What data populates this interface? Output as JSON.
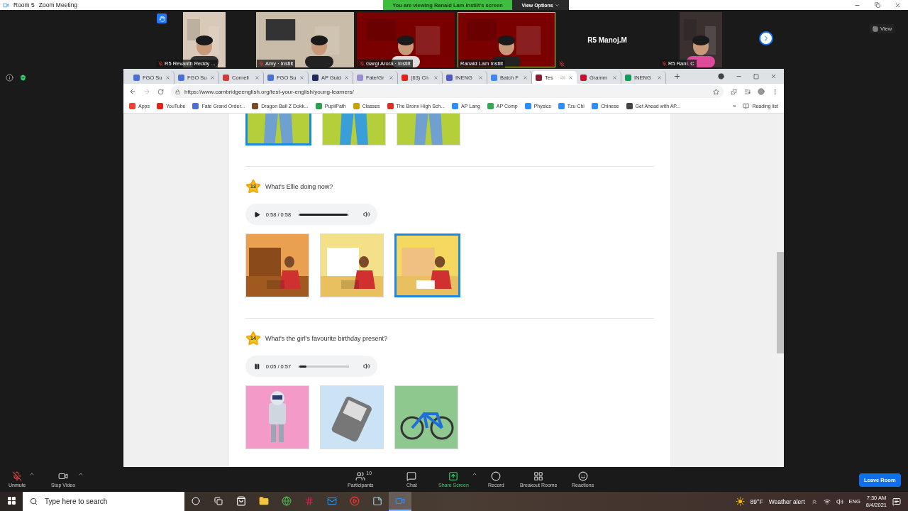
{
  "zoom_window": {
    "room": "Room 5",
    "title": "Zoom Meeting"
  },
  "share_banner": {
    "text": "You are viewing Ranald Lam Instilt's screen",
    "button": "View Options"
  },
  "participants": [
    {
      "name": "R5 Revanth Reddy ...",
      "kind": "video",
      "muted": true,
      "hand_raised": true,
      "selected": false
    },
    {
      "name": "Amy · Instilt",
      "kind": "video",
      "muted": true,
      "hand_raised": false,
      "selected": false
    },
    {
      "name": "Gargi Arora · Instilt",
      "kind": "video",
      "muted": true,
      "hand_raised": false,
      "selected": false
    },
    {
      "name": "Ranald Lam Instilt",
      "kind": "video",
      "muted": false,
      "hand_raised": false,
      "selected": true
    },
    {
      "name": "R5 Manoj.M",
      "kind": "name_only",
      "muted": true,
      "hand_raised": false,
      "selected": false
    },
    {
      "name": "R5 Rani. C",
      "kind": "video",
      "muted": true,
      "hand_raised": false,
      "selected": false
    }
  ],
  "view_button": "View",
  "browser": {
    "tabs": [
      {
        "title": "FGO Su",
        "color": "#4a6fd6",
        "selected": false,
        "audio": false
      },
      {
        "title": "FGO Su",
        "color": "#4a6fd6",
        "selected": false,
        "audio": false
      },
      {
        "title": "Cornell",
        "color": "#d23a3a",
        "selected": false,
        "audio": false
      },
      {
        "title": "FGO Su",
        "color": "#4a6fd6",
        "selected": false,
        "audio": false
      },
      {
        "title": "AP Guid",
        "color": "#1e2a5a",
        "selected": false,
        "audio": false
      },
      {
        "title": "Fate/Gr",
        "color": "#9b8fd0",
        "selected": false,
        "audio": false
      },
      {
        "title": "(63) Ch",
        "color": "#e62117",
        "selected": false,
        "audio": false
      },
      {
        "title": "INENG",
        "color": "#5059c9",
        "selected": false,
        "audio": false
      },
      {
        "title": "Batch F",
        "color": "#4285f4",
        "selected": false,
        "audio": false
      },
      {
        "title": "Tes",
        "color": "#8b1e2e",
        "selected": true,
        "audio": true
      },
      {
        "title": "Gramm",
        "color": "#c8102e",
        "selected": false,
        "audio": false
      },
      {
        "title": "INENG",
        "color": "#0f9d58",
        "selected": false,
        "audio": false
      }
    ],
    "url": "https://www.cambridgeenglish.org/test-your-english/young-learners/",
    "bookmarks": [
      {
        "label": "Apps",
        "color": "#ea4335"
      },
      {
        "label": "YouTube",
        "color": "#e62117"
      },
      {
        "label": "Fate Grand Order...",
        "color": "#4a6fd6"
      },
      {
        "label": "Dragon Ball Z Dokk...",
        "color": "#7a4a2a"
      },
      {
        "label": "PupilPath",
        "color": "#2e9e4f"
      },
      {
        "label": "Classes",
        "color": "#c9a400"
      },
      {
        "label": "The Bronx High Sch...",
        "color": "#d93025"
      },
      {
        "label": "AP Lang",
        "color": "#2d8cff"
      },
      {
        "label": "AP Comp",
        "color": "#34a853"
      },
      {
        "label": "Physics",
        "color": "#2d8cff"
      },
      {
        "label": "Tzu Chi",
        "color": "#2d8cff"
      },
      {
        "label": "Chinese",
        "color": "#2d8cff"
      },
      {
        "label": "Get Ahead with AP...",
        "color": "#444444"
      }
    ],
    "more": "»",
    "reading_list": "Reading list"
  },
  "questions": [
    {
      "images": [
        {
          "kind": "picture",
          "selected": true
        },
        {
          "kind": "picture",
          "selected": false
        },
        {
          "kind": "picture",
          "selected": false
        }
      ]
    },
    {
      "number": "13",
      "text": "What's Ellie doing now?",
      "player": {
        "playing": false,
        "time": "0:58 / 0:58",
        "level": 1
      },
      "images": [
        {
          "kind": "picture",
          "selected": false
        },
        {
          "kind": "picture",
          "selected": false
        },
        {
          "kind": "picture",
          "selected": true
        }
      ]
    },
    {
      "number": "14",
      "text": "What's the girl's favourite birthday present?",
      "player": {
        "playing": true,
        "time": "0:05 / 0:57",
        "level": 0.14
      },
      "images": [
        {
          "kind": "picture",
          "selected": false
        },
        {
          "kind": "picture",
          "selected": false
        },
        {
          "kind": "picture",
          "selected": false
        }
      ]
    }
  ],
  "toolbar": [
    {
      "label": "Unmute",
      "kind": "mic",
      "has_menu": true
    },
    {
      "label": "Stop Video",
      "kind": "video",
      "has_menu": true
    },
    {
      "label": "Participants",
      "kind": "participants",
      "badge": "10",
      "has_menu": false
    },
    {
      "label": "Chat",
      "kind": "chat",
      "has_menu": false
    },
    {
      "label": "Share Screen",
      "kind": "share",
      "has_menu": true
    },
    {
      "label": "Record",
      "kind": "record",
      "has_menu": false
    },
    {
      "label": "Breakout Rooms",
      "kind": "breakout",
      "has_menu": false
    },
    {
      "label": "Reactions",
      "kind": "reactions",
      "has_menu": false
    }
  ],
  "leave_button": "Leave Room",
  "taskbar": {
    "search_placeholder": "Type here to search",
    "apps": [
      {
        "kind": "store",
        "active": false
      },
      {
        "kind": "folder",
        "active": false
      },
      {
        "kind": "browser",
        "active": false
      },
      {
        "kind": "chat",
        "active": false
      },
      {
        "kind": "mail",
        "active": false
      },
      {
        "kind": "music",
        "active": false
      },
      {
        "kind": "notes",
        "active": false
      },
      {
        "kind": "meeting",
        "active": true
      }
    ],
    "temperature": "89°F",
    "weather": "Weather alert",
    "language": "ENG",
    "time": "7:30 AM",
    "date": "8/4/2021"
  }
}
